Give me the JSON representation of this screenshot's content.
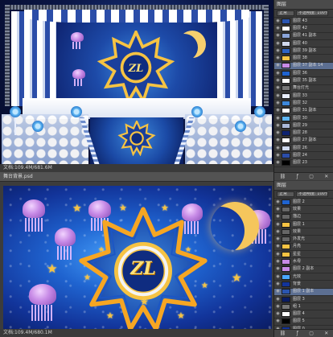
{
  "top_window": {
    "status_text": "文档:109.4M/681.6M"
  },
  "bottom_window": {
    "title": "舞台背景.psd",
    "status_text": "文档:109.4M/680.1M",
    "emblem_text": "ZL"
  },
  "colors": {
    "deep_blue": "#0a1c63",
    "bright_blue": "#4aa6ff",
    "gold": "#f6c343",
    "purple": "#c78ae6",
    "ps_panel": "#3b3b3b"
  },
  "panel_top": {
    "tab": "图层",
    "mode": "正常",
    "opacity": "不透明度: 100%",
    "layers": [
      {
        "name": "图层 43",
        "thumb": "#2a55b0"
      },
      {
        "name": "图层 42",
        "thumb": "#ffffff"
      },
      {
        "name": "图层 41 副本",
        "thumb": "#8aa4d8"
      },
      {
        "name": "图层 40",
        "thumb": "#d0d8ec"
      },
      {
        "name": "图层 39 副本",
        "thumb": "#2d63c4"
      },
      {
        "name": "图层 38",
        "thumb": "#f6c343"
      },
      {
        "name": "图层 37 副本 14",
        "thumb": "#c78ae6"
      },
      {
        "name": "图层 36",
        "thumb": "#1f63cf"
      },
      {
        "name": "图层 35 副本",
        "thumb": "#ffffff"
      },
      {
        "name": "舞台灯光",
        "thumb": "#777777"
      },
      {
        "name": "图层 33",
        "thumb": "#e8eefc"
      },
      {
        "name": "图层 32",
        "thumb": "#3d88da"
      },
      {
        "name": "图层 31 副本",
        "thumb": "#ffffff"
      },
      {
        "name": "图层 30",
        "thumb": "#5fb6f2"
      },
      {
        "name": "图层 29",
        "thumb": "#aab8d8"
      },
      {
        "name": "图层 28",
        "thumb": "#0e2370"
      },
      {
        "name": "图层 27 副本",
        "thumb": "#ffffff"
      },
      {
        "name": "图层 26",
        "thumb": "#cfd9ef"
      },
      {
        "name": "图层 24",
        "thumb": "#2b4da8"
      },
      {
        "name": "图层 23",
        "thumb": "#000000"
      }
    ]
  },
  "panel_bot": {
    "tab": "图层",
    "mode": "正常",
    "opacity": "不透明度: 100%",
    "layers": [
      {
        "name": "图层 2",
        "thumb": "#1f63cf"
      },
      {
        "name": "效果",
        "thumb": "#666666"
      },
      {
        "name": "描边",
        "thumb": "#666666"
      },
      {
        "name": "图层 1",
        "thumb": "#f6c343"
      },
      {
        "name": "效果",
        "thumb": "#666666"
      },
      {
        "name": "外发光",
        "thumb": "#666666"
      },
      {
        "name": "月亮",
        "thumb": "#f6c343"
      },
      {
        "name": "星星",
        "thumb": "#f6c343"
      },
      {
        "name": "水母",
        "thumb": "#c78ae6"
      },
      {
        "name": "图层 2 副本",
        "thumb": "#c78ae6"
      },
      {
        "name": "光效",
        "thumb": "#4aa6ff"
      },
      {
        "name": "背景",
        "thumb": "#12349a"
      },
      {
        "name": "图层 1 副本",
        "thumb": "#2a55b0"
      },
      {
        "name": "图层 3",
        "thumb": "#0a1c63"
      },
      {
        "name": "组 1",
        "thumb": "#777777"
      },
      {
        "name": "图层 4",
        "thumb": "#ffffff"
      },
      {
        "name": "图层 5",
        "thumb": "#000000"
      },
      {
        "name": "图层 0",
        "thumb": "#12349a"
      }
    ]
  }
}
